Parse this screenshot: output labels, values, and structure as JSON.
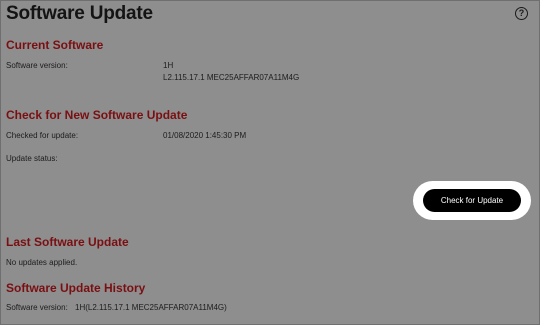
{
  "page": {
    "title": "Software Update",
    "help_icon": "question-circle-icon",
    "help_glyph": "?"
  },
  "current_software": {
    "heading": "Current Software",
    "version_label": "Software version:",
    "version_line1": "1H",
    "version_line2": "L2.115.17.1 MEC25AFFAR07A11M4G"
  },
  "check_update": {
    "heading": "Check for New Software Update",
    "checked_label": "Checked for update:",
    "checked_value": "01/08/2020 1:45:30 PM",
    "status_label": "Update status:",
    "status_value": "",
    "button_label": "Check for Update"
  },
  "last_update": {
    "heading": "Last Software Update",
    "text": "No updates applied."
  },
  "history": {
    "heading": "Software Update History",
    "entry_label": "Software version:",
    "entry_value": "1H(L2.115.17.1 MEC25AFFAR07A11M4G)"
  },
  "colors": {
    "background": "#8e8e8e",
    "section_heading": "#7a0f12",
    "button_bg": "#000000",
    "button_text": "#ffffff",
    "highlight_ring": "#ffffff"
  }
}
